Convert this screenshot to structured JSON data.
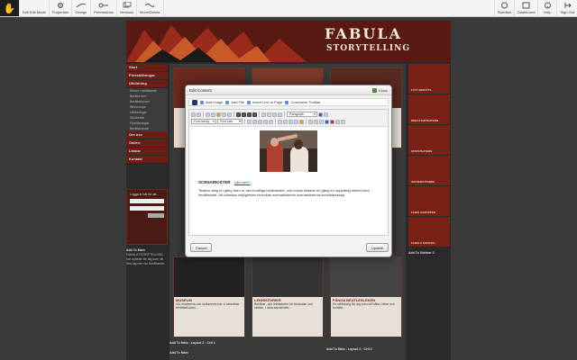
{
  "toolbar": {
    "logo": "✋",
    "left": [
      {
        "label": "Exit Edit Mode"
      },
      {
        "label": "Properties"
      },
      {
        "label": "Design"
      },
      {
        "label": "Permissions"
      },
      {
        "label": "Versions"
      },
      {
        "label": "Move/Delete"
      }
    ],
    "right": [
      {
        "label": "Swedish"
      },
      {
        "label": "Dashboard"
      },
      {
        "label": "Help"
      },
      {
        "label": "Sign Out"
      }
    ]
  },
  "site": {
    "logo_title": "FABULA",
    "logo_subtitle": "STORYTELLING",
    "nav": [
      {
        "label": "Start"
      },
      {
        "label": "Föreställningar"
      },
      {
        "label": "Utbildning"
      }
    ],
    "nav_sub": [
      "Kurser i berättande",
      "Berätta mer",
      "Berättarkurser",
      "Workshops",
      "Utbildningar",
      "Skolbesök",
      "Föreläsningar",
      "Berättarskola"
    ],
    "nav2": [
      {
        "label": "Om oss"
      },
      {
        "label": "Galleri"
      },
      {
        "label": "Länkar"
      },
      {
        "label": "Kontakt"
      }
    ],
    "login_title": "Logga in här för att...",
    "login_button": "Skicka",
    "add_to_main": "Add To Main",
    "news_text": "FABULA STORYTELLING har nyheter för dig som vill lära dig mer om berättande.",
    "thumbs": [
      {
        "title": "MUSEUM",
        "text": "Vid museerna och kulturarvet har vi utvecklat berättarkurser..."
      },
      {
        "title": "LEKHISTORIER",
        "text": "Berättar- och lekhistorier för förskolan och skolan, i nära samarbete..."
      },
      {
        "title": "FÅNGA BEATLESLEKEN",
        "text": "En utbildning för dig som vill hålla i lekar och berätta..."
      }
    ],
    "add_cell1": "Add To Main : Layout 2 : Cell 1",
    "add_cell2": "Add To Main : Layout 2 : Cell 2",
    "add_main": "Add To Main",
    "right_items": [
      "FÅTT BERÄTTA",
      "BERÄTTARTEATERN",
      "STATSTEATERN",
      "OM BERÄTTANDE",
      "FABULAGRUPPEN",
      "FABULA FESTIVAL"
    ],
    "add_sidebar": "Add To Sidebar 2"
  },
  "modal": {
    "title": "Edit Content",
    "close_label": "Close",
    "tools": [
      {
        "label": "Add Image"
      },
      {
        "label": "Add File"
      },
      {
        "label": "Insert Link to Page"
      },
      {
        "label": "Customize Toolbar"
      }
    ],
    "format_select": "Paragraph",
    "font_family_select": "Font family",
    "font_size_select": "Font size",
    "heading": "SCENARKISTER",
    "heading_link": "Läs mer!!!",
    "body_text": "Teatern steg en gång fram ur det muntliga berättandet, och musik bildade en gång en supplistig helhet med berättandet. Att utforska möjligheten utvecklar scenarkisterns scenarkisterna konstnärsskap.",
    "cancel_label": "Cancel",
    "update_label": "Update"
  },
  "colors": {
    "accent_red": "#7a2016",
    "banner": "#5a1a14",
    "backdrop": "#3a3a3a"
  }
}
